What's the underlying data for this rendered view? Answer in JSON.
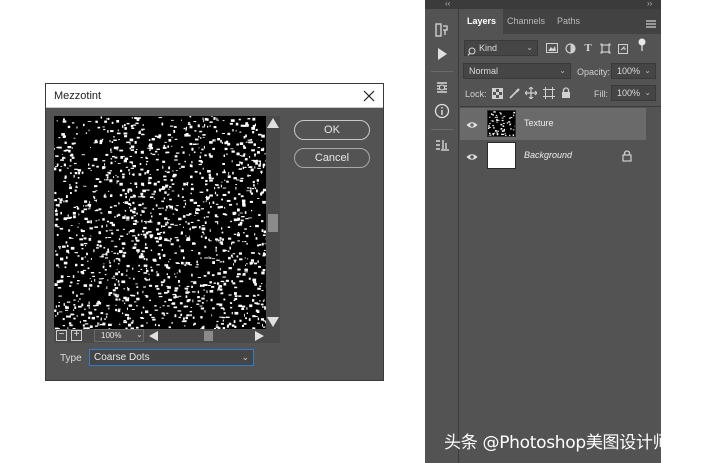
{
  "dialog": {
    "title": "Mezzotint",
    "ok_label": "OK",
    "cancel_label": "Cancel",
    "zoom": "100%",
    "type_label": "Type",
    "type_value": "Coarse Dots",
    "icons": {
      "close": "close-icon",
      "zoom_out": "minus-icon",
      "zoom_in": "plus-icon"
    }
  },
  "panel": {
    "tabs": [
      "Layers",
      "Channels",
      "Paths"
    ],
    "active_tab": "Layers",
    "filter_kind": "Kind",
    "blend_mode": "Normal",
    "opacity_label": "Opacity:",
    "opacity": "100%",
    "lock_label": "Lock:",
    "fill_label": "Fill:",
    "fill": "100%",
    "layers": [
      {
        "name": "Texture",
        "selected": true,
        "visible": true,
        "thumb": "noise"
      },
      {
        "name": "Background",
        "selected": false,
        "visible": true,
        "locked": true,
        "thumb": "white"
      }
    ],
    "toolbar_icons": [
      "history-icon",
      "play-icon",
      "paragraph-icon",
      "info-icon",
      "layer-comps-icon"
    ]
  },
  "colors": {
    "dialog_bg": "#535353",
    "panel_bg": "#535353",
    "tab_bar": "#424242",
    "selected_layer": "#6a6a6a",
    "focus_border": "#2f7bd4"
  },
  "watermark": "头条 @Photoshop美图设计师"
}
